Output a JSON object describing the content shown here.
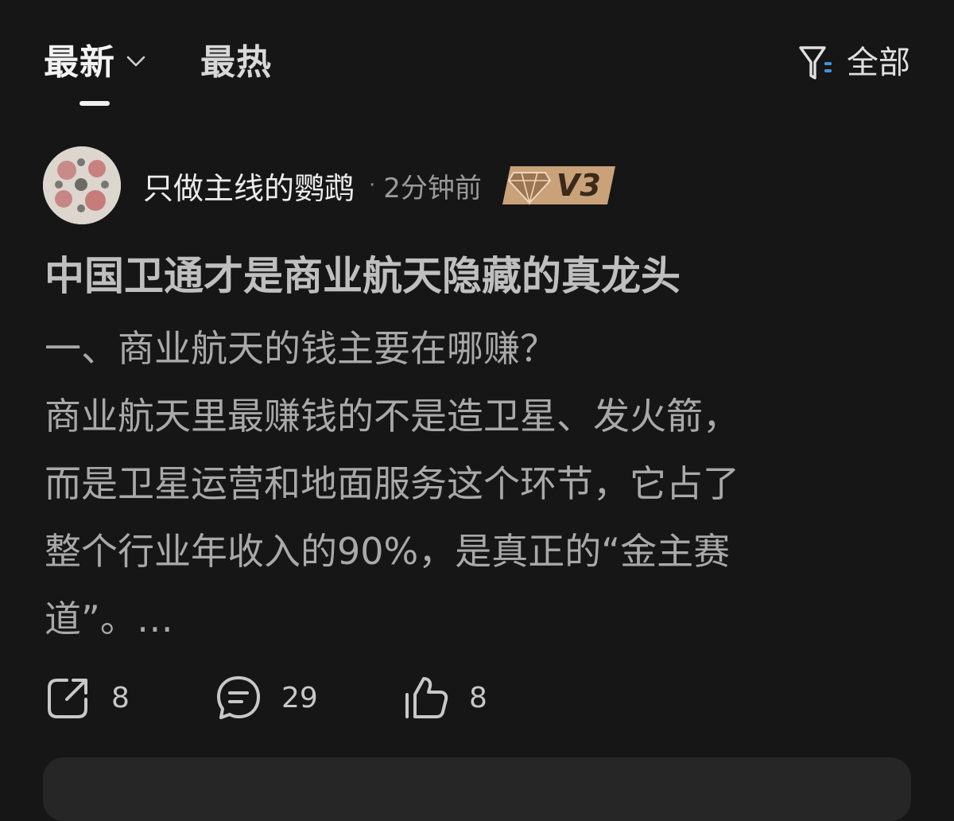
{
  "tabs": {
    "latest_label": "最新",
    "hot_label": "最热",
    "active": "latest"
  },
  "filter": {
    "label": "全部",
    "icon": "filter-icon"
  },
  "post": {
    "author": {
      "name": "只做主线的鹦鹉",
      "time": "2分钟前",
      "level": "V3",
      "separator": "·"
    },
    "title": "中国卫通才是商业航天隐藏的真龙头",
    "body_lines": [
      "一、商业航天的钱主要在哪赚？",
      "商业航天里最赚钱的不是造卫星、发火箭，",
      "而是卫星运营和地面服务这个环节，它占了",
      "整个行业年收入的90%，是真正的“金主赛",
      "道”。…"
    ],
    "actions": {
      "share_count": "8",
      "comment_count": "29",
      "like_count": "8"
    }
  },
  "colors": {
    "background": "#161616",
    "badge_gold": "#c9a27a",
    "filter_accent": "#4a90d9"
  }
}
